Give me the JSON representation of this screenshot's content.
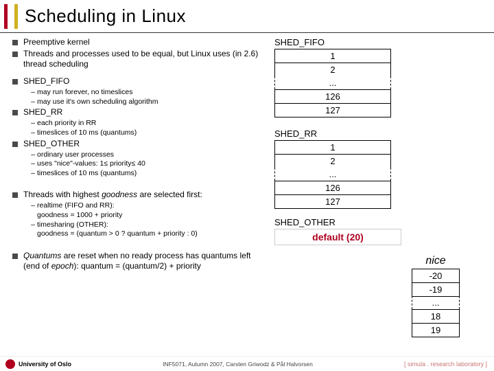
{
  "title": "Scheduling in Linux",
  "bullets": {
    "b1": "Preemptive kernel",
    "b2": "Threads and processes used to be equal, but Linux uses (in 2.6) thread scheduling",
    "b3": "SHED_FIFO",
    "b3s1": "may run forever, no timeslices",
    "b3s2": "may use it's own scheduling algorithm",
    "b4": "SHED_RR",
    "b4s1": "each priority in RR",
    "b4s2": "timeslices of 10 ms (quantums)",
    "b5": "SHED_OTHER",
    "b5s1": "ordinary user processes",
    "b5s2": "uses \"nice\"-values: 1≤ priority≤ 40",
    "b5s3": "timeslices of 10 ms (quantums)",
    "b6a": "Threads with highest ",
    "b6b": "goodness",
    "b6c": " are selected first:",
    "b6s1a": "realtime (FIFO and RR):",
    "b6s1b": "goodness = 1000 + priority",
    "b6s2a": "timesharing (OTHER):",
    "b6s2b": "goodness = (quantum > 0 ? quantum + priority : 0)",
    "b7a": "Quantums",
    "b7b": " are reset when no ready process has quantums left (end of ",
    "b7c": "epoch",
    "b7d": "): quantum = (quantum/2) + priority"
  },
  "diagram": {
    "fifo_label": "SHED_FIFO",
    "fifo": {
      "r1": "1",
      "r2": "2",
      "dots": "...",
      "r126": "126",
      "r127": "127"
    },
    "rr_label": "SHED_RR",
    "rr": {
      "r1": "1",
      "r2": "2",
      "dots": "...",
      "r126": "126",
      "r127": "127"
    },
    "other_label": "SHED_OTHER",
    "other_default": "default (20)"
  },
  "nice": {
    "title": "nice",
    "rn20": "-20",
    "rn19": "-19",
    "dots": "...",
    "r18": "18",
    "r19": "19"
  },
  "footer": {
    "uni": "University of Oslo",
    "course": "INF5071, Autumn 2007, Carsten Griwodz & Pål Halvorsen",
    "simula": "[ simula . research laboratory ]"
  }
}
